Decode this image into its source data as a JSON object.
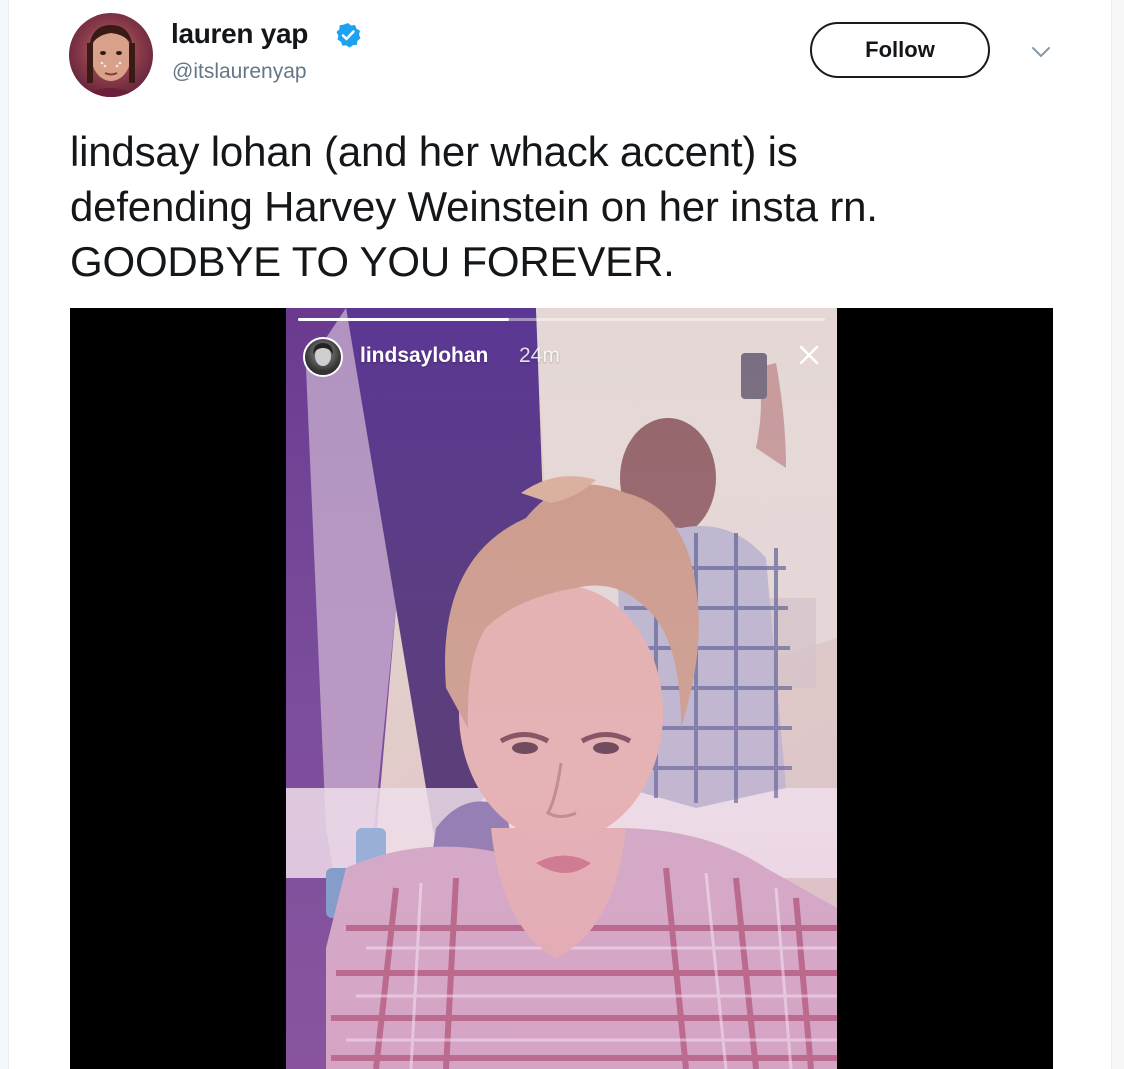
{
  "tweet": {
    "author": {
      "display_name": "lauren yap",
      "handle": "@itslaurenyap",
      "verified": true,
      "verified_icon": "verified-badge-icon",
      "avatar_icon": "user-avatar"
    },
    "follow_button_label": "Follow",
    "menu_icon": "chevron-down-icon",
    "text_lines": [
      "lindsay lohan (and her whack accent) is",
      "defending Harvey Weinstein on her insta rn.",
      "GOODBYE TO YOU FOREVER."
    ],
    "media": {
      "type": "video",
      "story": {
        "username": "lindsaylohan",
        "time_ago": "24m",
        "progress": 0.4,
        "close_icon": "close-icon"
      }
    }
  },
  "colors": {
    "text_primary": "#14171a",
    "text_secondary": "#657786",
    "verified_blue": "#1da1f2",
    "media_background": "#000000"
  }
}
